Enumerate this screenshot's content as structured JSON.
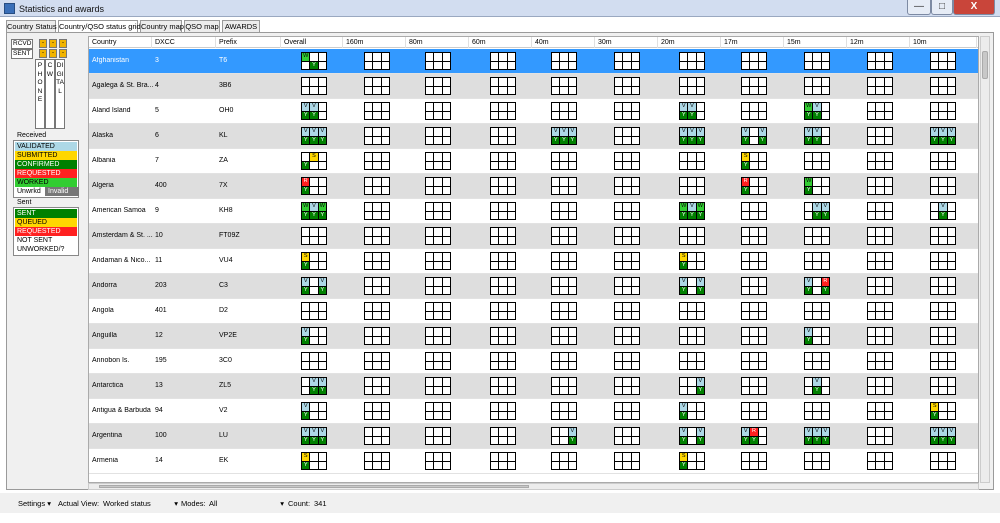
{
  "title": "Statistics and awards",
  "window_buttons": {
    "minimize": "—",
    "maximize": "□",
    "close": "X"
  },
  "tabs": [
    "Country Status",
    "Country/QSO status grid",
    "Country map",
    "QSO map",
    "AWARDS"
  ],
  "legend": {
    "rcvd": "RCVD",
    "sent": "SENT",
    "swatch": "-",
    "modes": [
      "PHONE",
      "CW",
      "DIGITAL"
    ],
    "received_title": "Received",
    "received": [
      {
        "label": "VALIDATED",
        "color": "#add8e6"
      },
      {
        "label": "SUBMITTED",
        "color": "#ffd700"
      },
      {
        "label": "CONFIRMED",
        "color": "#008000"
      },
      {
        "label": "REQUESTED",
        "color": "#ff2020"
      },
      {
        "label": "WORKED",
        "color": "#32cd32"
      },
      {
        "label": "Unwrkd",
        "color": "#ffffff"
      }
    ],
    "invalid": "Invalid",
    "sent_title": "Sent",
    "sent_items": [
      {
        "label": "SENT",
        "color": "#008000"
      },
      {
        "label": "QUEUED",
        "color": "#ffd700"
      },
      {
        "label": "REQUESTED",
        "color": "#ff2020"
      },
      {
        "label": "NOT SENT",
        "color": "#ffffff"
      },
      {
        "label": "UNWORKED/?",
        "color": "#ffffff"
      }
    ]
  },
  "colors": {
    "V": "#add8e6",
    "Y": "#008000",
    "S": "#ffd700",
    "R": "#ff2020",
    "W": "#32cd32"
  },
  "columns": [
    "Country",
    "DXCC",
    "Prefix",
    "Overall",
    "160m",
    "80m",
    "60m",
    "40m",
    "30m",
    "20m",
    "17m",
    "15m",
    "12m",
    "10m"
  ],
  "rows": [
    {
      "c": "Afghanistan",
      "d": "3",
      "p": "T6",
      "g": {
        "3": "W||||Y|"
      }
    },
    {
      "c": "Agalega & St. Bra...",
      "d": "4",
      "p": "3B6",
      "g": {}
    },
    {
      "c": "Aland Island",
      "d": "5",
      "p": "OH0",
      "g": {
        "3": "V|V||Y|Y|",
        "9": "V|V||Y|Y|",
        "11": "W|V||Y|Y|"
      }
    },
    {
      "c": "Alaska",
      "d": "6",
      "p": "KL",
      "g": {
        "3": "V|V|V|Y|Y|Y",
        "7": "V|V|V|Y|Y|Y",
        "9": "V|V|V|Y|Y|Y",
        "10": "V||V|Y||Y",
        "11": "V|V||Y|Y|",
        "13": "V|V|V|Y|Y|Y"
      }
    },
    {
      "c": "Albania",
      "d": "7",
      "p": "ZA",
      "g": {
        "3": "|S||Y||",
        "10": "S|||Y||"
      }
    },
    {
      "c": "Algeria",
      "d": "400",
      "p": "7X",
      "g": {
        "3": "R|||Y||",
        "10": "R|||Y||",
        "11": "W|||Y||"
      }
    },
    {
      "c": "American Samoa",
      "d": "9",
      "p": "KH8",
      "g": {
        "3": "W|V|W|Y|Y|Y",
        "9": "W|V|W|Y|Y|Y",
        "11": "|V|V||Y|Y",
        "13": "|V|||Y|"
      }
    },
    {
      "c": "Amsterdam & St. ...",
      "d": "10",
      "p": "FT09Z",
      "g": {}
    },
    {
      "c": "Andaman & Nico...",
      "d": "11",
      "p": "VU4",
      "g": {
        "3": "S|||Y||",
        "9": "S|||Y||"
      }
    },
    {
      "c": "Andorra",
      "d": "203",
      "p": "C3",
      "g": {
        "3": "V||V|Y||Y",
        "9": "V||V|Y||Y",
        "11": "V||R|Y||Y"
      }
    },
    {
      "c": "Angola",
      "d": "401",
      "p": "D2",
      "g": {}
    },
    {
      "c": "Anguilla",
      "d": "12",
      "p": "VP2E",
      "g": {
        "3": "V|||Y||",
        "11": "V|||Y||"
      }
    },
    {
      "c": "Annobon Is.",
      "d": "195",
      "p": "3C0",
      "g": {}
    },
    {
      "c": "Antarctica",
      "d": "13",
      "p": "ZL5",
      "g": {
        "3": "|V|V||Y|Y",
        "9": "||V|||Y",
        "11": "|V|||Y|"
      }
    },
    {
      "c": "Antigua & Barbuda",
      "d": "94",
      "p": "V2",
      "g": {
        "3": "V|||Y||",
        "9": "V|||Y||",
        "13": "S|||Y||"
      }
    },
    {
      "c": "Argentina",
      "d": "100",
      "p": "LU",
      "g": {
        "3": "V|V|V|Y|Y|Y",
        "7": "||V|||Y",
        "9": "V||V|Y||Y",
        "10": "V|R||Y|Y|",
        "11": "V|V|V|Y|Y|Y",
        "13": "V|V|V|Y|Y|Y"
      }
    },
    {
      "c": "Armenia",
      "d": "14",
      "p": "EK",
      "g": {
        "3": "S|||Y||",
        "9": "S|||Y||"
      }
    }
  ],
  "status": {
    "settings": "Settings",
    "actual_view_label": "Actual View:",
    "actual_view": "Worked status",
    "modes_label": "Modes:",
    "modes": "All",
    "count_label": "Count:",
    "count": "341"
  }
}
